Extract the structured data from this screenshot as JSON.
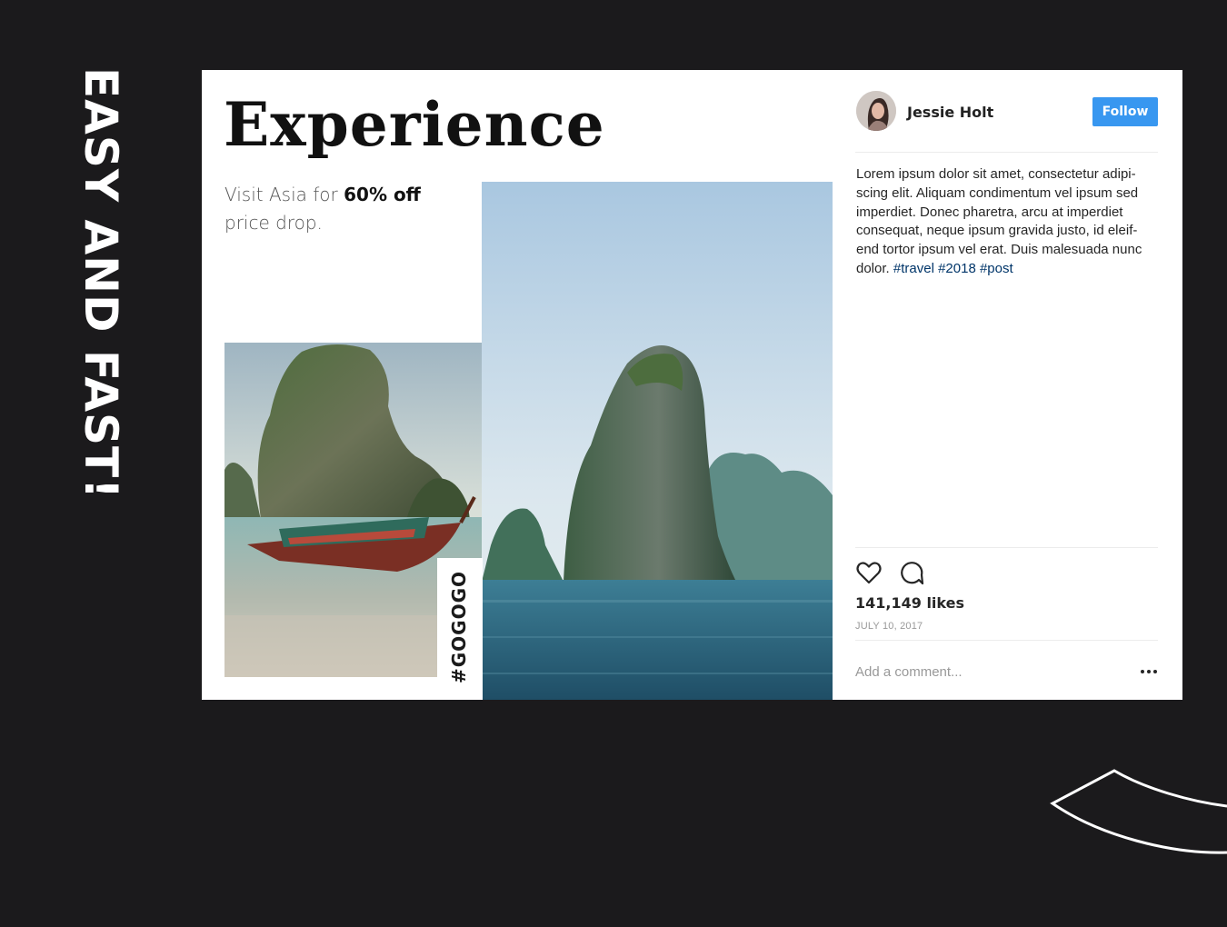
{
  "side_title": "EASY AND FAST!",
  "post": {
    "headline": "Experience",
    "promo_prefix": "Visit Asia for ",
    "promo_highlight": "60% off",
    "promo_suffix": "price drop.",
    "photo_hashtag": "#GOGOGO"
  },
  "panel": {
    "username": "Jessie Holt",
    "follow_label": "Follow",
    "caption_text": "Lorem ipsum dolor sit amet, consectetur adipi-scing elit. Aliquam condimentum vel ipsum sed imperdiet. Donec pharetra, arcu at imperdiet consequat, neque ipsum gravida justo, id eleif-end tortor ipsum vel erat. Duis malesuada nunc dolor.",
    "tags": [
      "#travel",
      "#2018",
      "#post"
    ],
    "likes": "141,149 likes",
    "date": "JULY 10, 2017",
    "comment_placeholder": "Add a comment..."
  },
  "icons": {
    "like": "heart-icon",
    "comment": "comment-bubble-icon",
    "more": "more-dots-icon"
  },
  "colors": {
    "background": "#1b1a1c",
    "follow_button": "#3897f0",
    "hashtag_link": "#003569"
  }
}
